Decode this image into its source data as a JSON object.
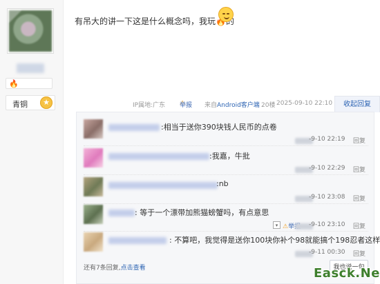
{
  "user": {
    "rank_label": "青铜",
    "rank_badge": "★"
  },
  "post": {
    "text_before_icon": "有吊大的讲一下这是什么概念吗，我玩",
    "text_after_icon": "的",
    "fire_icon_glyph": "🔥",
    "ip_location": "IP属地:广东",
    "report_label": "举报",
    "source_prefix": "来自",
    "source_client": "Android客户端",
    "floor": "20楼",
    "datetime": "2025-09-10 22:10",
    "collapse_label": "收起回复"
  },
  "replies": [
    {
      "text": ":相当于送你390块钱人民币的点卷",
      "time_suffix": "-9-10 22:19",
      "reply_label": "回复"
    },
    {
      "text": ":我嘉，牛批",
      "time_suffix": "-9-10 22:29",
      "reply_label": "回复"
    },
    {
      "text": ":nb",
      "time_suffix": "-9-10 23:08",
      "reply_label": "回复"
    },
    {
      "text": ": 等于一个漂带加熊猫螃蟹吗，有点意思",
      "time_suffix": "-9-10 23:10",
      "reply_label": "回复",
      "report_label": "举报"
    },
    {
      "text": ": 不算吧，我觉得是送你100块你补个98就能搞个198忍者这样",
      "time_suffix": "-9-11 00:30",
      "reply_label": "回复"
    }
  ],
  "footer": {
    "more_text": "还有7条回复,",
    "view_link": "点击查看",
    "say_button": "我也说一句"
  },
  "watermark": "Easck.Net",
  "colors": {
    "link_blue": "#2d64b3",
    "warn_orange": "#f0a020",
    "watermark_green": "#3e7f2d"
  }
}
